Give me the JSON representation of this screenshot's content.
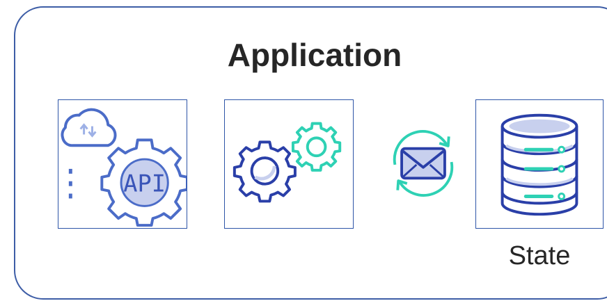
{
  "diagram": {
    "title": "Application",
    "components": [
      {
        "icon": "cloud-api-gear-icon",
        "label": ""
      },
      {
        "icon": "gears-icon",
        "label": ""
      },
      {
        "icon": "message-sync-icon",
        "label": ""
      },
      {
        "icon": "database-icon",
        "label": "State"
      }
    ],
    "api_text": "API"
  },
  "colors": {
    "border": "#2d54a7",
    "navy": "#2a3fa8",
    "teal": "#2ed1b4",
    "lavender": "#c8d0ee",
    "text": "#262626"
  }
}
